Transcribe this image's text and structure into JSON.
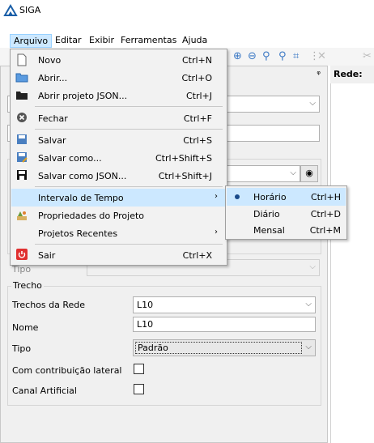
{
  "window": {
    "title": "SIGA"
  },
  "menubar": [
    {
      "label": "Arquivo"
    },
    {
      "label": "Editar"
    },
    {
      "label": "Exibir"
    },
    {
      "label": "Ferramentas"
    },
    {
      "label": "Ajuda"
    }
  ],
  "right_panel": {
    "title": "Rede:"
  },
  "file_menu": {
    "items": [
      {
        "label": "Novo",
        "shortcut": "Ctrl+N",
        "icon": "new-file-icon"
      },
      {
        "label": "Abrir...",
        "shortcut": "Ctrl+O",
        "icon": "open-folder-icon"
      },
      {
        "label": "Abrir projeto JSON...",
        "shortcut": "Ctrl+J",
        "icon": "open-json-icon"
      },
      {
        "label": "Fechar",
        "shortcut": "Ctrl+F",
        "icon": "close-icon"
      },
      {
        "label": "Salvar",
        "shortcut": "Ctrl+S",
        "icon": "save-icon"
      },
      {
        "label": "Salvar como...",
        "shortcut": "Ctrl+Shift+S",
        "icon": "save-as-icon"
      },
      {
        "label": "Salvar como JSON...",
        "shortcut": "Ctrl+Shift+J",
        "icon": "save-json-icon"
      },
      {
        "label": "Intervalo de Tempo",
        "submenu_arrow": "›"
      },
      {
        "label": "Propriedades do Projeto",
        "icon": "properties-icon"
      },
      {
        "label": "Projetos Recentes",
        "submenu_arrow": "›"
      },
      {
        "label": "Sair",
        "shortcut": "Ctrl+X",
        "icon": "exit-icon"
      }
    ]
  },
  "time_submenu": {
    "items": [
      {
        "label": "Horário",
        "shortcut": "Ctrl+H",
        "selected": true
      },
      {
        "label": "Diário",
        "shortcut": "Ctrl+D"
      },
      {
        "label": "Mensal",
        "shortcut": "Ctrl+M"
      }
    ]
  },
  "form": {
    "tipo_label": "Tipo",
    "trecho_group": "Trecho",
    "trechos_label": "Trechos da Rede",
    "trechos_value": "L10",
    "nome_label": "Nome",
    "nome_value": "L10",
    "tipo2_label": "Tipo",
    "tipo2_value": "Padrão",
    "contrib_label": "Com contribuição lateral",
    "canal_label": "Canal Artificial"
  },
  "colors": {
    "highlight": "#cce8ff",
    "menu_bg": "#f2f2f2",
    "panel_bg": "#f0f0f0"
  }
}
